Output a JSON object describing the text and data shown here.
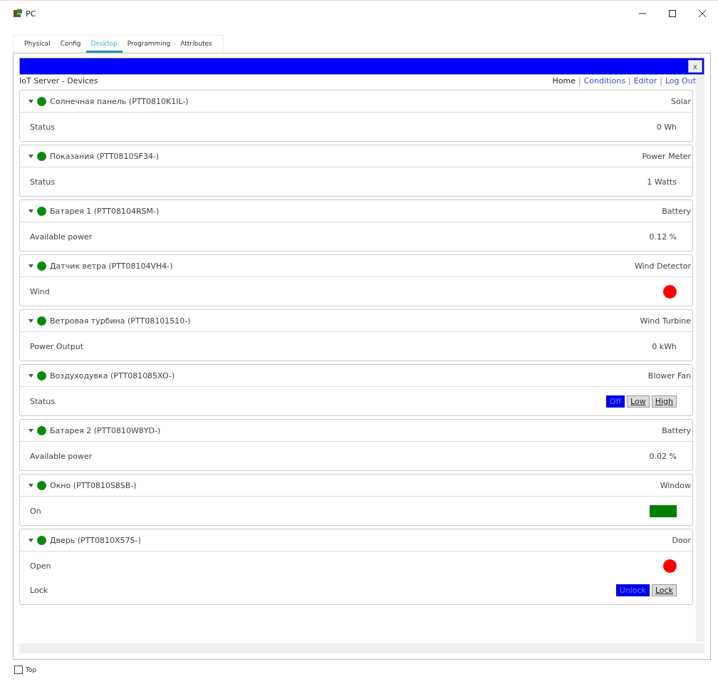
{
  "window": {
    "title": "PC"
  },
  "tabs": [
    {
      "label": "Physical",
      "selected": false
    },
    {
      "label": "Config",
      "selected": false
    },
    {
      "label": "Desktop",
      "selected": true
    },
    {
      "label": "Programming",
      "selected": false
    },
    {
      "label": "Attributes",
      "selected": false
    }
  ],
  "browser": {
    "close": "x",
    "heading": "IoT Server - Devices",
    "nav": [
      {
        "label": "Home",
        "selected": true
      },
      {
        "label": "Conditions",
        "selected": false
      },
      {
        "label": "Editor",
        "selected": false
      },
      {
        "label": "Log Out",
        "selected": false
      }
    ],
    "separator": "|"
  },
  "devices": [
    {
      "name": "Солнечная панель (PTT0810K1IL-)",
      "type": "Solar",
      "online": true,
      "rows": [
        {
          "label": "Status",
          "kind": "text",
          "value": "0 Wh"
        }
      ]
    },
    {
      "name": "Показания (PTT0810SF34-)",
      "type": "Power Meter",
      "online": true,
      "rows": [
        {
          "label": "Status",
          "kind": "text",
          "value": "1 Watts"
        }
      ]
    },
    {
      "name": "Батарея 1 (PTT08104RSM-)",
      "type": "Battery",
      "online": true,
      "rows": [
        {
          "label": "Available power",
          "kind": "text",
          "value": "0.12 %"
        }
      ]
    },
    {
      "name": "Датчик ветра (PTT08104VH4-)",
      "type": "Wind Detector",
      "online": true,
      "rows": [
        {
          "label": "Wind",
          "kind": "led",
          "color": "#ff0000"
        }
      ]
    },
    {
      "name": "Ветровая турбина (PTT08101510-)",
      "type": "Wind Turbine",
      "online": true,
      "rows": [
        {
          "label": "Power Output",
          "kind": "text",
          "value": "0 kWh"
        }
      ]
    },
    {
      "name": "Воздуходувка (PTT081085XO-)",
      "type": "Blower Fan",
      "online": true,
      "rows": [
        {
          "label": "Status",
          "kind": "buttons",
          "buttons": [
            {
              "label": "Off",
              "selected": true
            },
            {
              "label": "Low",
              "selected": false
            },
            {
              "label": "High",
              "selected": false
            }
          ]
        }
      ]
    },
    {
      "name": "Батарея 2 (PTT0810W8YD-)",
      "type": "Battery",
      "online": true,
      "rows": [
        {
          "label": "Available power",
          "kind": "text",
          "value": "0.02 %"
        }
      ]
    },
    {
      "name": "Окно (PTT0810S8SB-)",
      "type": "Window",
      "online": true,
      "rows": [
        {
          "label": "On",
          "kind": "swatch",
          "color": "#008000"
        }
      ]
    },
    {
      "name": "Дверь (PTT0810X575-)",
      "type": "Door",
      "online": true,
      "rows": [
        {
          "label": "Open",
          "kind": "led",
          "color": "#ff0000"
        },
        {
          "label": "Lock",
          "kind": "buttons",
          "buttons": [
            {
              "label": "Unlock",
              "selected": true
            },
            {
              "label": "Lock",
              "selected": false
            }
          ]
        }
      ]
    }
  ],
  "top": {
    "label": "Top",
    "checked": false
  }
}
